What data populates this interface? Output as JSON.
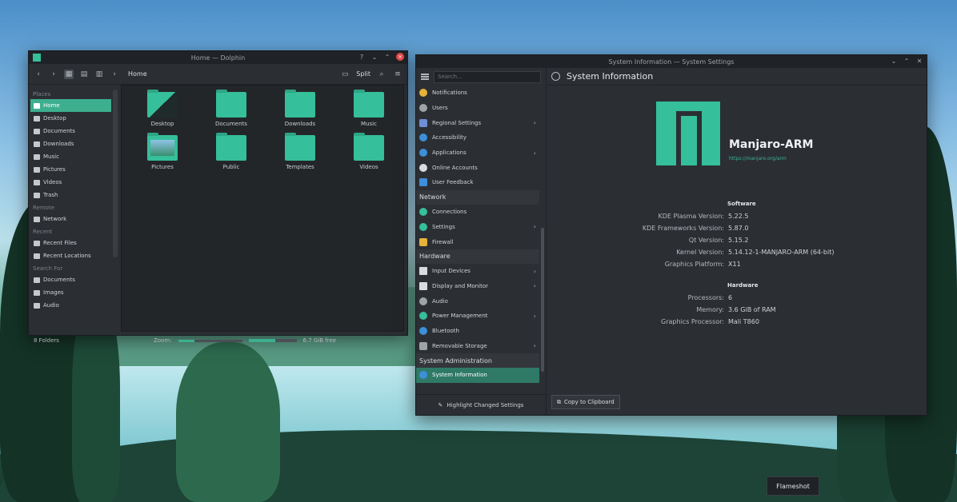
{
  "dolphin": {
    "title": "Home — Dolphin",
    "breadcrumb": "Home",
    "split_label": "Split",
    "sidebar": {
      "places_head": "Places",
      "places": [
        "Home",
        "Desktop",
        "Documents",
        "Downloads",
        "Music",
        "Pictures",
        "Videos",
        "Trash"
      ],
      "remote_head": "Remote",
      "remote": [
        "Network"
      ],
      "recent_head": "Recent",
      "recent": [
        "Recent Files",
        "Recent Locations"
      ],
      "search_head": "Search For",
      "search": [
        "Documents",
        "Images",
        "Audio"
      ]
    },
    "folders": [
      "Desktop",
      "Documents",
      "Downloads",
      "Music",
      "Pictures",
      "Public",
      "Templates",
      "Videos"
    ],
    "status_count": "8 Folders",
    "zoom_label": "Zoom:",
    "zoom_level": 0.25,
    "disk_used": 0.55,
    "free_space": "6.7 GiB free"
  },
  "settings": {
    "title": "System Information — System Settings",
    "search_placeholder": "Search...",
    "page_title": "System Information",
    "categories_top": [
      "Notifications",
      "Users",
      "Regional Settings",
      "Accessibility",
      "Applications",
      "Online Accounts",
      "User Feedback"
    ],
    "section_network": "Network",
    "categories_network": [
      "Connections",
      "Settings",
      "Firewall"
    ],
    "section_hardware": "Hardware",
    "categories_hardware": [
      "Input Devices",
      "Display and Monitor",
      "Audio",
      "Power Management",
      "Bluetooth",
      "Removable Storage"
    ],
    "section_admin": "System Administration",
    "categories_admin": [
      "System Information"
    ],
    "highlight_label": "Highlight Changed Settings",
    "distro_name": "Manjaro-ARM",
    "distro_url": "https://manjaro.org/arm",
    "software_head": "Software",
    "software": [
      {
        "k": "KDE Plasma Version:",
        "v": "5.22.5"
      },
      {
        "k": "KDE Frameworks Version:",
        "v": "5.87.0"
      },
      {
        "k": "Qt Version:",
        "v": "5.15.2"
      },
      {
        "k": "Kernel Version:",
        "v": "5.14.12-1-MANJARO-ARM (64-bit)"
      },
      {
        "k": "Graphics Platform:",
        "v": "X11"
      }
    ],
    "hardware_head": "Hardware",
    "hardware": [
      {
        "k": "Processors:",
        "v": "6"
      },
      {
        "k": "Memory:",
        "v": "3.6 GiB of RAM"
      },
      {
        "k": "Graphics Processor:",
        "v": "Mali T860"
      }
    ],
    "copy_label": "Copy to Clipboard"
  },
  "flameshot": {
    "label": "Flameshot"
  },
  "colors": {
    "accent": "#35bf9a",
    "selection": "#3daf8f",
    "window_bg": "#2b2f34"
  }
}
